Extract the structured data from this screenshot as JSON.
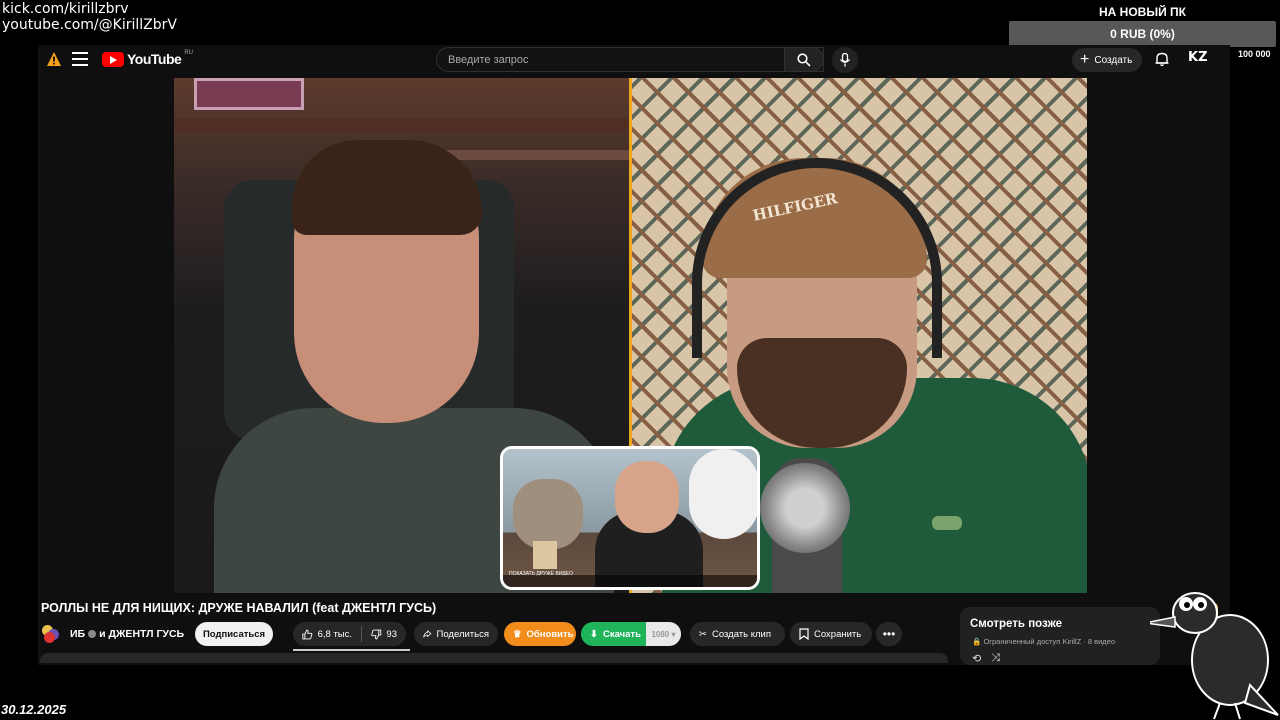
{
  "overlay": {
    "links": [
      "kick.com/kirillzbrv",
      "youtube.com/@KirillZbrV"
    ],
    "date": "30.12.2025"
  },
  "goal": {
    "title": "НА НОВЫЙ ПК",
    "bar_text": "0 RUB (0%)",
    "progress": 0,
    "min": "0",
    "max": "100 000"
  },
  "youtube": {
    "logo_text": "YouTube",
    "country": "RU",
    "search_placeholder": "Введите запрос",
    "create_label": "Создать",
    "avatar_text": "KZ",
    "video": {
      "pip_caption": "ПОКАЗАТЬ ДРУЖЕ ВИДЕО"
    },
    "title": "РОЛЛЫ НЕ ДЛЯ НИЩИХ: ДРУЖЕ НАВАЛИЛ (feat ДЖЕНТЛ ГУСЬ)",
    "channel": {
      "name_main": "ИБ",
      "name_extra": "и ДЖЕНТЛ ГУСЬ"
    },
    "actions": {
      "subscribe": "Подписаться",
      "likes": "6,8 тыс.",
      "dislikes": "93",
      "share": "Поделиться",
      "update": "Обновить",
      "download": "Скачать",
      "quality": "1080",
      "clip": "Создать клип",
      "save": "Сохранить",
      "more": "•••"
    },
    "watch_later": {
      "title": "Смотреть позже",
      "access": "Ограниченный доступ",
      "owner": "KirillZ",
      "count": "8 видео"
    }
  },
  "colors": {
    "accent_divider": "#f0a71e",
    "update_button": "#f28c1b",
    "download_button": "#1fb35a",
    "youtube_red": "#ff0000"
  }
}
